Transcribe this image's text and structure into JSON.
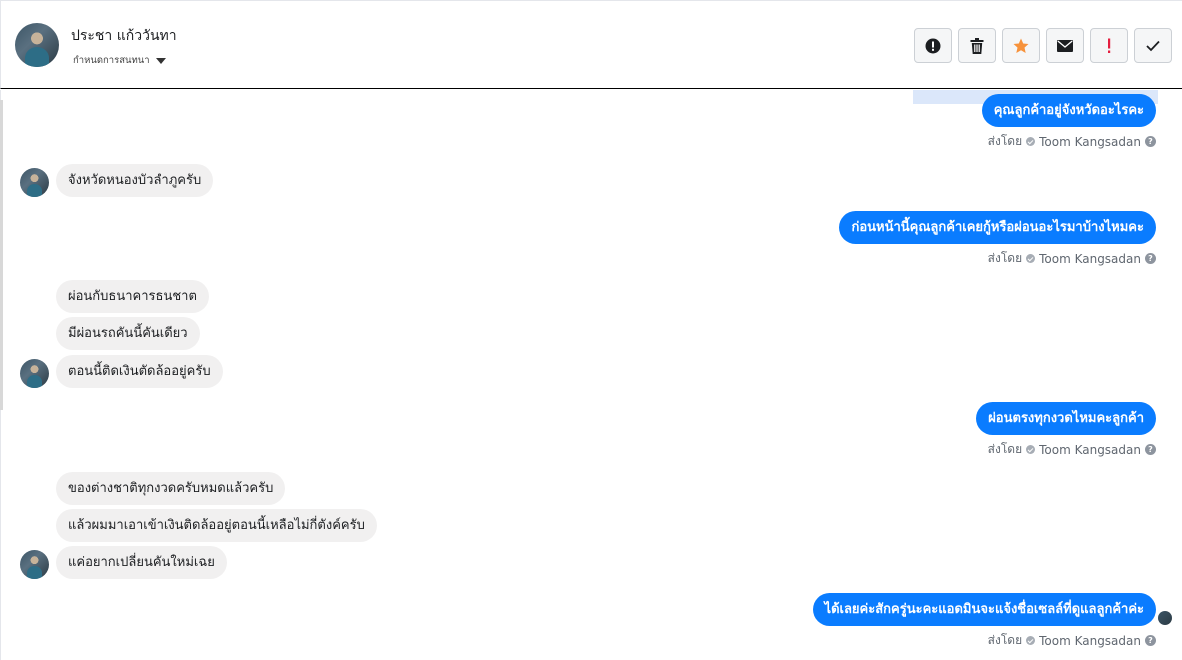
{
  "header": {
    "contact_name": "ประชา แก้ววันทา",
    "assign_label": "กำหนดการสนทนา"
  },
  "actions": [
    {
      "name": "alert-icon"
    },
    {
      "name": "trash-icon"
    },
    {
      "name": "star-icon",
      "color": "#f7923b"
    },
    {
      "name": "envelope-icon"
    },
    {
      "name": "exclamation-icon",
      "color": "#e41e3f"
    },
    {
      "name": "check-icon"
    }
  ],
  "messages": [
    {
      "dir": "out",
      "text": "คุณลูกค้าอยู่จังหวัดอะไรคะ"
    },
    {
      "dir": "in",
      "text": "จังหวัดหนองบัวลำภูครับ"
    },
    {
      "dir": "out",
      "text": "ก่อนหน้านี้คุณลูกค้าเคยกู้หรือผ่อนอะไรมาบ้างไหมคะ"
    },
    {
      "dir": "in",
      "text": "ผ่อนกับธนาคารธนชาต"
    },
    {
      "dir": "in",
      "text": "มีผ่อนรถคันนี้คันเดียว"
    },
    {
      "dir": "in",
      "text": "ตอนนี้ติดเงินตัดล้ออยู่ครับ"
    },
    {
      "dir": "out",
      "text": "ผ่อนตรงทุกงวดไหมคะลูกค้า"
    },
    {
      "dir": "in",
      "text": "ของต่างชาติทุกงวดครับหมดแล้วครับ"
    },
    {
      "dir": "in",
      "text": "แล้วผมมาเอาเข้าเงินติดล้ออยู่ตอนนี้เหลือไม่กี่ตังค์ครับ"
    },
    {
      "dir": "in",
      "text": "แค่อยากเปลี่ยนคันใหม่เฉย"
    },
    {
      "dir": "out",
      "text": "ได้เลยค่ะสักครู่นะคะแอดมินจะแจ้งชื่อเซลล์ที่ดูแลลูกค้าค่ะ"
    }
  ],
  "sent_by": {
    "prefix": "ส่งโดย",
    "agent": "Toom Kangsadan",
    "help": "?"
  },
  "colors": {
    "outgoing_bubble": "#0a7cff",
    "incoming_bubble": "#f1f0f0"
  }
}
